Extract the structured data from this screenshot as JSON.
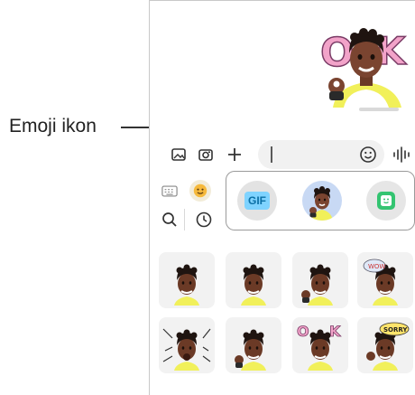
{
  "callout": {
    "label": "Emoji ikon"
  },
  "chat": {
    "sent_sticker_icon": "avatar-ok-sticker-icon",
    "timestamp_text": ""
  },
  "input_bar": {
    "gallery_icon": "image-icon",
    "camera_icon": "camera-icon",
    "add_icon": "plus-icon",
    "field_value": "",
    "emoji_icon": "smiley-icon",
    "voice_icon": "voice-wave-icon"
  },
  "emoji_panel": {
    "keyboard_icon": "keyboard-icon",
    "emoji_tab_icon": "emoji-face-icon",
    "search_icon": "search-icon",
    "recent_icon": "clock-icon",
    "tabs": [
      {
        "label": "GIF",
        "icon": "gif-icon"
      },
      {
        "label": "",
        "icon": "avatar-emoji-icon"
      },
      {
        "label": "",
        "icon": "sticker-icon"
      }
    ]
  },
  "stickers": [
    {
      "icon": "avatar-neutral-sticker"
    },
    {
      "icon": "avatar-smile-sticker"
    },
    {
      "icon": "avatar-wave-sticker"
    },
    {
      "icon": "avatar-wow-sticker"
    },
    {
      "icon": "avatar-shout-sticker"
    },
    {
      "icon": "avatar-hi-sticker"
    },
    {
      "icon": "avatar-ok-sticker"
    },
    {
      "icon": "avatar-sorry-sticker"
    }
  ],
  "colors": {
    "skin": "#6b3a26",
    "hair": "#1f1410",
    "shirt": "#f1f05a",
    "ok_text": "#f2a3c9",
    "accent_green": "#34c471"
  }
}
